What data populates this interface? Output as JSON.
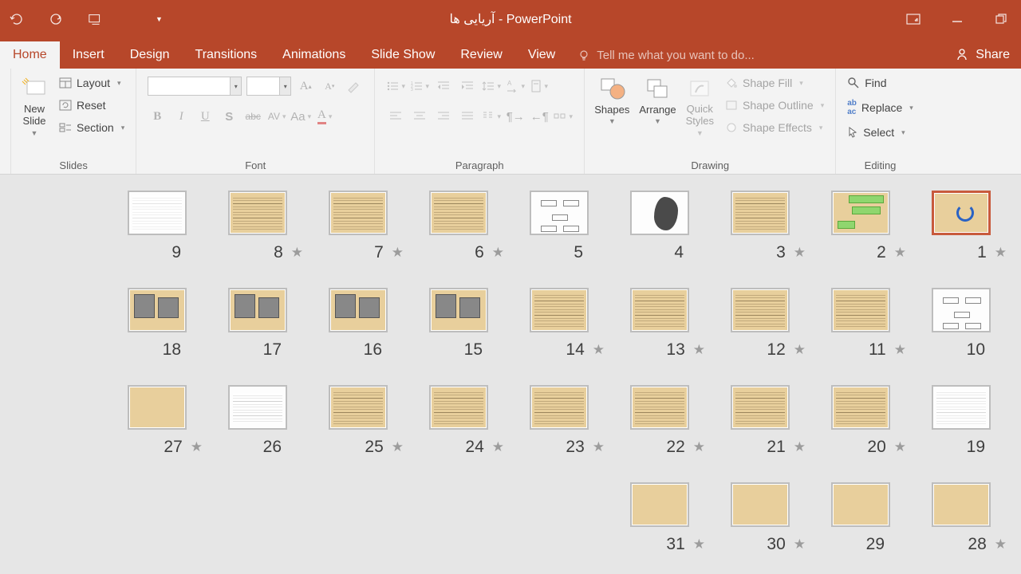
{
  "title": "آریایی ها - PowerPoint",
  "tabs": [
    "Home",
    "Insert",
    "Design",
    "Transitions",
    "Animations",
    "Slide Show",
    "Review",
    "View"
  ],
  "active_tab": "Home",
  "tell_me": "Tell me what you want to do...",
  "share": "Share",
  "groups": {
    "slides": {
      "label": "Slides",
      "new_slide": "New\nSlide",
      "layout": "Layout",
      "reset": "Reset",
      "section": "Section"
    },
    "font": {
      "label": "Font"
    },
    "paragraph": {
      "label": "Paragraph"
    },
    "drawing": {
      "label": "Drawing",
      "shapes": "Shapes",
      "arrange": "Arrange",
      "quick_styles": "Quick\nStyles",
      "shape_fill": "Shape Fill",
      "shape_outline": "Shape Outline",
      "shape_effects": "Shape Effects"
    },
    "editing": {
      "label": "Editing",
      "find": "Find",
      "replace": "Replace",
      "select": "Select"
    }
  },
  "slides": [
    {
      "n": 1,
      "star": true,
      "kind": "spinner",
      "sel": true
    },
    {
      "n": 2,
      "star": true,
      "kind": "green"
    },
    {
      "n": 3,
      "star": true,
      "kind": "text"
    },
    {
      "n": 4,
      "star": false,
      "kind": "map"
    },
    {
      "n": 5,
      "star": false,
      "kind": "diagram-white"
    },
    {
      "n": 6,
      "star": true,
      "kind": "text"
    },
    {
      "n": 7,
      "star": true,
      "kind": "text"
    },
    {
      "n": 8,
      "star": true,
      "kind": "text"
    },
    {
      "n": 9,
      "star": false,
      "kind": "map-white"
    },
    {
      "n": 10,
      "star": false,
      "kind": "diagram-white"
    },
    {
      "n": 11,
      "star": true,
      "kind": "text"
    },
    {
      "n": 12,
      "star": true,
      "kind": "text"
    },
    {
      "n": 13,
      "star": true,
      "kind": "text"
    },
    {
      "n": 14,
      "star": true,
      "kind": "text"
    },
    {
      "n": 15,
      "star": false,
      "kind": "photo-multi"
    },
    {
      "n": 16,
      "star": false,
      "kind": "photo-multi"
    },
    {
      "n": 17,
      "star": false,
      "kind": "photo-multi"
    },
    {
      "n": 18,
      "star": false,
      "kind": "photo-multi"
    },
    {
      "n": 19,
      "star": false,
      "kind": "tools-white"
    },
    {
      "n": 20,
      "star": true,
      "kind": "text"
    },
    {
      "n": 21,
      "star": true,
      "kind": "text"
    },
    {
      "n": 22,
      "star": true,
      "kind": "text"
    },
    {
      "n": 23,
      "star": true,
      "kind": "text"
    },
    {
      "n": 24,
      "star": true,
      "kind": "text"
    },
    {
      "n": 25,
      "star": true,
      "kind": "text"
    },
    {
      "n": 26,
      "star": false,
      "kind": "table-white"
    },
    {
      "n": 27,
      "star": true,
      "kind": "blank"
    },
    {
      "n": 28,
      "star": true,
      "kind": "blank"
    },
    {
      "n": 29,
      "star": false,
      "kind": "blank"
    },
    {
      "n": 30,
      "star": true,
      "kind": "blank"
    },
    {
      "n": 31,
      "star": true,
      "kind": "blank"
    }
  ]
}
